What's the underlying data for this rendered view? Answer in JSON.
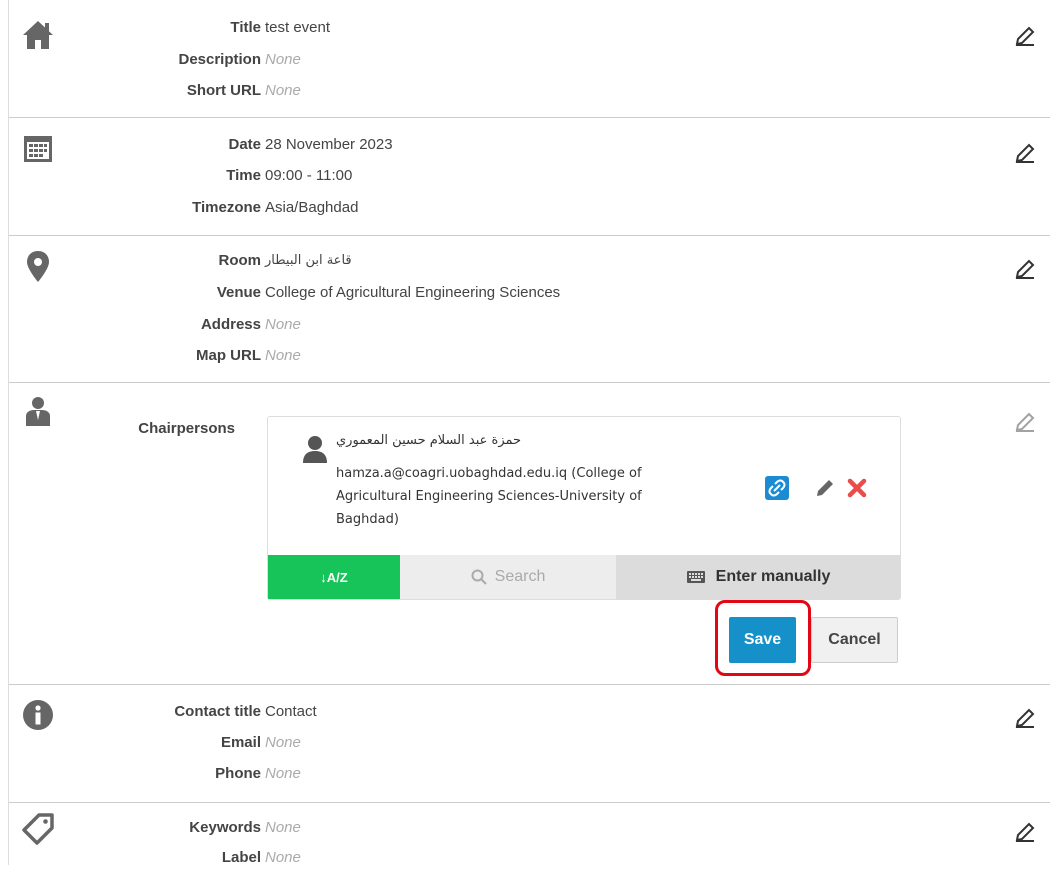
{
  "general": {
    "title_label": "Title",
    "title_value": "test event",
    "description_label": "Description",
    "description_value": "None",
    "short_url_label": "Short URL",
    "short_url_value": "None"
  },
  "datetime": {
    "date_label": "Date",
    "date_value": "28 November 2023",
    "time_label": "Time",
    "time_value": "09:00 - 11:00",
    "timezone_label": "Timezone",
    "timezone_value": "Asia/Baghdad"
  },
  "location": {
    "room_label": "Room",
    "room_value": "قاعة ابن البيطار",
    "venue_label": "Venue",
    "venue_value": "College of Agricultural Engineering Sciences",
    "address_label": "Address",
    "address_value": "None",
    "map_url_label": "Map URL",
    "map_url_value": "None"
  },
  "chairpersons": {
    "label": "Chairpersons",
    "person": {
      "name": "حمزة عبد السلام حسين المعموري",
      "detail": "hamza.a@coagri.uobaghdad.edu.iq (College of Agricultural Engineering Sciences-University of Baghdad)"
    },
    "toolbar": {
      "sort_label": "↓A/Z",
      "search_label": "Search",
      "manual_label": "Enter manually"
    },
    "save_label": "Save",
    "cancel_label": "Cancel"
  },
  "contact": {
    "contact_title_label": "Contact title",
    "contact_title_value": "Contact",
    "email_label": "Email",
    "email_value": "None",
    "phone_label": "Phone",
    "phone_value": "None"
  },
  "classification": {
    "keywords_label": "Keywords",
    "keywords_value": "None",
    "label_label": "Label",
    "label_value": "None"
  },
  "colors": {
    "save": "#1690c8",
    "highlight": "#e30613",
    "sort": "#17c45a"
  }
}
